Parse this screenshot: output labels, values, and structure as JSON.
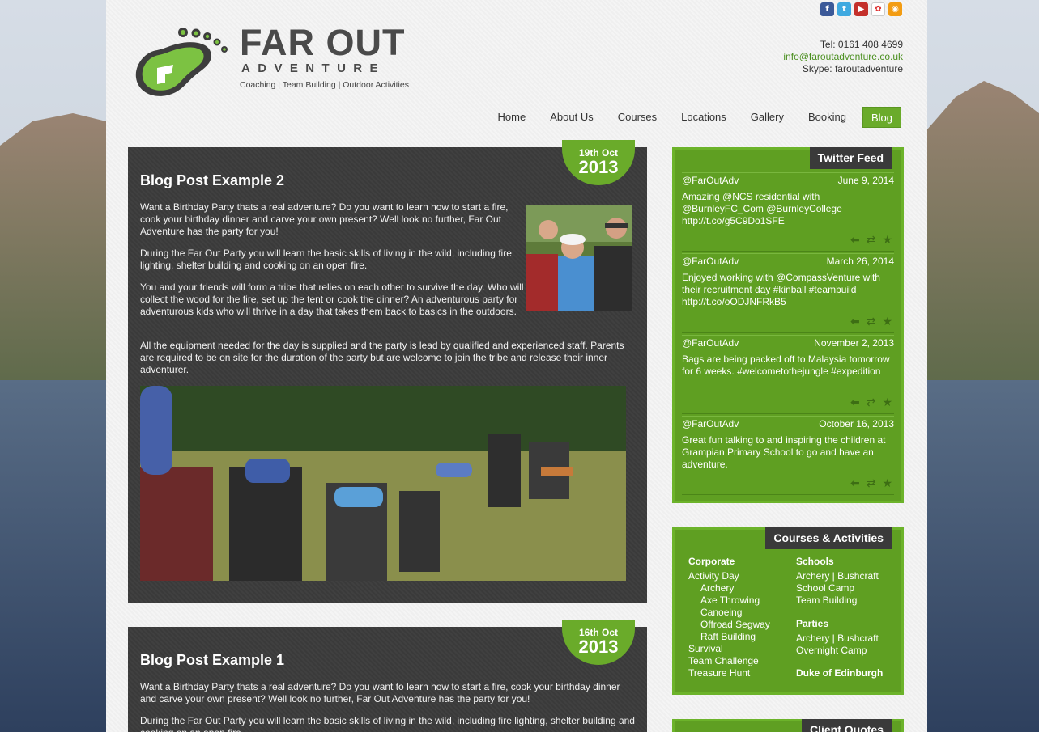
{
  "social": [
    {
      "icon": "facebook-icon",
      "glyph": "f",
      "color": "#3b5998"
    },
    {
      "icon": "twitter-icon",
      "glyph": "t",
      "color": "#3fa9e0"
    },
    {
      "icon": "youtube-icon",
      "glyph": "▶",
      "color": "#c4302b"
    },
    {
      "icon": "picasa-icon",
      "glyph": "✿",
      "color": "#ffffff"
    },
    {
      "icon": "rss-icon",
      "glyph": "◉",
      "color": "#f39c12"
    }
  ],
  "brand": {
    "line1": "FAR OUT",
    "line2": "ADVENTURE",
    "tagline": "Coaching | Team Building | Outdoor Activities"
  },
  "contact": {
    "tel": "Tel: 0161 408 4699",
    "email": "info@faroutadventure.co.uk",
    "skype": "Skype: faroutadventure"
  },
  "nav": {
    "home": "Home",
    "about": "About Us",
    "courses": "Courses",
    "locations": "Locations",
    "gallery": "Gallery",
    "booking": "Booking",
    "blog": "Blog"
  },
  "posts": [
    {
      "date": "19th Oct",
      "year": "2013",
      "title": "Blog Post Example 2",
      "p1": "Want a Birthday Party thats a real adventure? Do you want to learn how to start a fire, cook your birthday dinner and carve your own present? Well look no further, Far Out Adventure has the party for you!",
      "p2": "During the Far Out Party you will learn the basic skills of living in the wild, including fire lighting, shelter building and cooking on an open fire.",
      "p3": "You and your friends will form a tribe that relies on each other to survive the day. Who will collect the wood for the fire, set up the tent or cook the dinner? An adventurous party for adventurous kids who will thrive in a day that takes them back to basics in the outdoors.",
      "p4": "All the equipment needed for the day is supplied and the party is lead by qualified and experienced staff. Parents are required to be on site for the duration of the party but are welcome to join the tribe and release their inner adventurer."
    },
    {
      "date": "16th Oct",
      "year": "2013",
      "title": "Blog Post Example 1",
      "p1": "Want a Birthday Party thats a real adventure? Do you want to learn how to start a fire, cook your birthday dinner and carve your own present? Well look no further, Far Out Adventure has the party for you!",
      "p2": "During the Far Out Party you will learn the basic skills of living in the wild, including fire lighting, shelter building and cooking on an open fire."
    }
  ],
  "twitter": {
    "title": "Twitter Feed",
    "tweets": [
      {
        "user": "@FarOutAdv",
        "date": "June 9, 2014",
        "text": "Amazing @NCS residential with @BurnleyFC_Com @BurnleyCollege http://t.co/g5C9Do1SFE"
      },
      {
        "user": "@FarOutAdv",
        "date": "March 26, 2014",
        "text": "Enjoyed working with @CompassVenture with their recruitment day #kinball #teambuild http://t.co/oODJNFRkB5"
      },
      {
        "user": "@FarOutAdv",
        "date": "November 2, 2013",
        "text": "Bags are being packed off to Malaysia tomorrow for 6 weeks. #welcometothejungle #expedition"
      },
      {
        "user": "@FarOutAdv",
        "date": "October 16, 2013",
        "text": "Great fun talking to and inspiring the children at Grampian Primary School to go and have an adventure."
      }
    ]
  },
  "courses": {
    "title": "Courses & Activities",
    "corporate": {
      "heading": "Corporate",
      "items": [
        "Activity Day",
        "Archery",
        "Axe Throwing",
        "Canoeing",
        "Offroad Segway",
        "Raft Building",
        "Survival",
        "Team Challenge",
        "Treasure Hunt"
      ]
    },
    "schools": {
      "heading": "Schools",
      "items": [
        "Archery | Bushcraft",
        "School Camp",
        "Team Building"
      ]
    },
    "parties": {
      "heading": "Parties",
      "items": [
        "Archery | Bushcraft",
        "Overnight Camp"
      ]
    },
    "doe": "Duke of Edinburgh"
  },
  "quotes": {
    "title": "Client Quotes"
  }
}
